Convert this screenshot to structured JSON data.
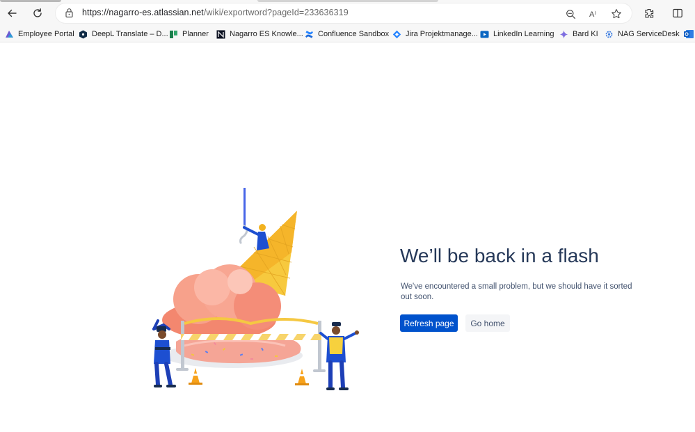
{
  "browser": {
    "url_host": "https://nagarro-es.atlassian.net",
    "url_path": "/wiki/exportword?pageId=233636319",
    "read_aloud_glyph": "A⁾",
    "bookmarks": [
      {
        "label": "Employee Portal",
        "icon": "employee-portal-icon"
      },
      {
        "label": "DeepL Translate – D...",
        "icon": "deepl-icon"
      },
      {
        "label": "Planner",
        "icon": "planner-icon"
      },
      {
        "label": "Nagarro ES Knowle...",
        "icon": "nagarro-icon"
      },
      {
        "label": "Confluence Sandbox",
        "icon": "confluence-icon"
      },
      {
        "label": "Jira Projektmanage...",
        "icon": "jira-icon"
      },
      {
        "label": "LinkedIn Learning",
        "icon": "linkedin-learning-icon"
      },
      {
        "label": "Bard KI",
        "icon": "bard-icon"
      },
      {
        "label": "NAG ServiceDesk",
        "icon": "servicedesk-icon"
      }
    ]
  },
  "error_page": {
    "heading": "We’ll be back in a flash",
    "message": "We've encountered a small problem, but we should have it sorted out soon.",
    "refresh_label": "Refresh page",
    "home_label": "Go home"
  },
  "colors": {
    "primary_button": "#0052cc",
    "heading_text": "#253858",
    "body_text": "#42526e"
  }
}
